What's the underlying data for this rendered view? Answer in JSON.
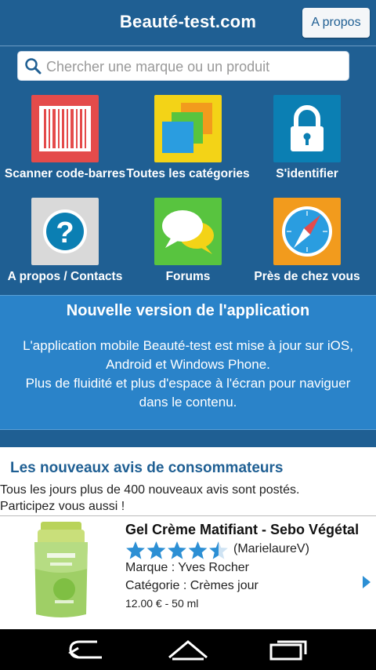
{
  "header": {
    "title": "Beauté-test.com",
    "about_label": "A propos"
  },
  "search": {
    "placeholder": "Chercher une marque ou un produit"
  },
  "tiles": [
    {
      "label": "Scanner code-barres",
      "icon": "barcode-icon",
      "color": "#e44b4b"
    },
    {
      "label": "Toutes les catégories",
      "icon": "categories-icon",
      "color": "#f3d317"
    },
    {
      "label": "S'identifier",
      "icon": "lock-icon",
      "color": "#0b7fb3"
    },
    {
      "label": "A propos / Contacts",
      "icon": "question-icon",
      "color": "#d9d9d9"
    },
    {
      "label": "Forums",
      "icon": "chat-bubbles-icon",
      "color": "#58c43f"
    },
    {
      "label": "Près de chez vous",
      "icon": "compass-icon",
      "color": "#f29b1d"
    }
  ],
  "news": {
    "title": "Nouvelle version de l'application",
    "lines": [
      "L'application mobile Beauté-test est mise à jour sur iOS,",
      "Android et Windows Phone.",
      "Plus de fluidité et plus d'espace à l'écran pour naviguer",
      "dans le contenu."
    ]
  },
  "reviews": {
    "title": "Les nouveaux avis de consommateurs",
    "intro_line1": "Tous les jours plus de 400 nouveaux avis sont postés.",
    "intro_line2": "Participez vous aussi !"
  },
  "product": {
    "name": "Gel Crème Matifiant - Sebo Végétal",
    "rating": 4.5,
    "rating_max": 5,
    "author": "(MarielaureV)",
    "brand": "Marque : Yves Rocher",
    "category": "Catégorie : Crèmes jour",
    "price": "12.00 € - 50 ml"
  },
  "navbar": {
    "back_icon": "back-icon",
    "home_icon": "home-icon",
    "recents_icon": "recents-icon"
  }
}
